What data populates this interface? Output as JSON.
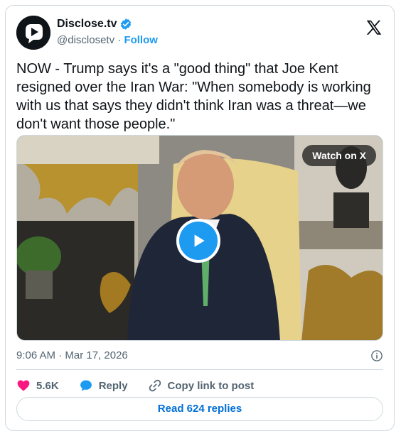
{
  "account": {
    "name": "Disclose.tv",
    "handle": "@disclosetv",
    "separator": " · ",
    "follow_label": "Follow",
    "verified": true
  },
  "tweet": {
    "text": "NOW - Trump says it's a \"good thing\" that Joe Kent resigned over the Iran War: \"When somebody is working with us that says they didn't think Iran was a threat—we don't want those people.\"",
    "timestamp": "9:06 AM · Mar 17, 2026"
  },
  "media": {
    "watch_label": "Watch on X"
  },
  "actions": {
    "likes": "5.6K",
    "reply_label": "Reply",
    "copy_label": "Copy link to post"
  },
  "replies_button": "Read 624 replies",
  "colors": {
    "accent": "#1d9bf0",
    "like": "#f91880",
    "link": "#006fd6"
  },
  "icons": [
    "disclose-logo-icon",
    "verified-badge-icon",
    "x-logo-icon",
    "play-icon",
    "info-icon",
    "heart-icon",
    "reply-bubble-icon",
    "link-icon"
  ]
}
